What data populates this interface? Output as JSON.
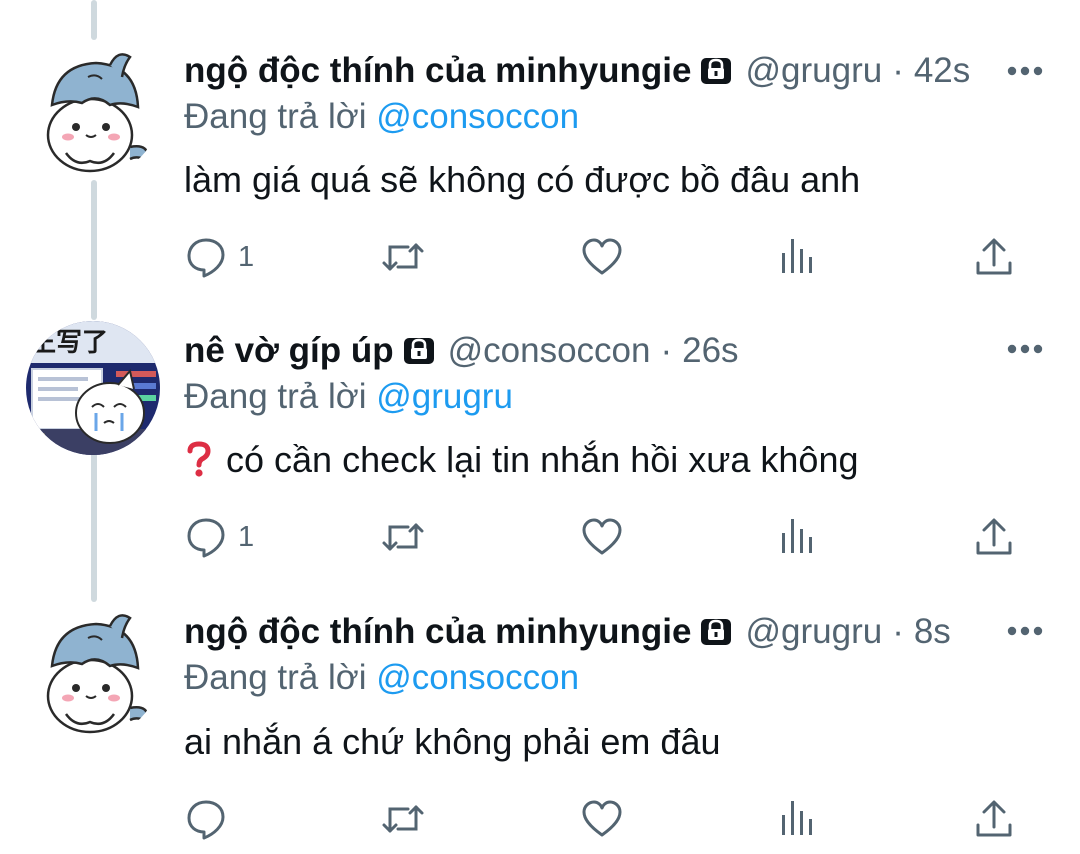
{
  "tweets": [
    {
      "display_name": "ngộ độc thính của minhyungie",
      "handle": "@grugru",
      "dot": "·",
      "time": "42s",
      "reply_prefix": "Đang trả lời ",
      "reply_to": "@consoccon",
      "text": "làm giá quá sẽ không có được bồ đâu anh",
      "reply_count": "1",
      "avatar_icon": "blue-hat-creature-avatar"
    },
    {
      "display_name": "nê vờ gíp úp",
      "handle": "@consoccon",
      "dot": "·",
      "time": "26s",
      "reply_prefix": "Đang trả lời ",
      "reply_to": "@grugru",
      "question_icon": "❓",
      "text": "có cần check lại tin nhắn hồi xưa không",
      "reply_count": "1",
      "avatar_icon": "crying-creature-at-computer-avatar"
    },
    {
      "display_name": "ngộ độc thính của minhyungie",
      "handle": "@grugru",
      "dot": "·",
      "time": "8s",
      "reply_prefix": "Đang trả lời ",
      "reply_to": "@consoccon",
      "text": "ai nhắn á chứ không phải em đâu",
      "reply_count": "",
      "avatar_icon": "blue-hat-creature-avatar"
    }
  ],
  "colors": {
    "text": "#0f1419",
    "secondary": "#536471",
    "accent": "#1d9bf0",
    "thread_line": "#cfd9de"
  },
  "icons": [
    "lock-icon",
    "more-icon",
    "reply-icon",
    "retweet-icon",
    "like-icon",
    "views-icon",
    "share-icon",
    "question-icon"
  ]
}
